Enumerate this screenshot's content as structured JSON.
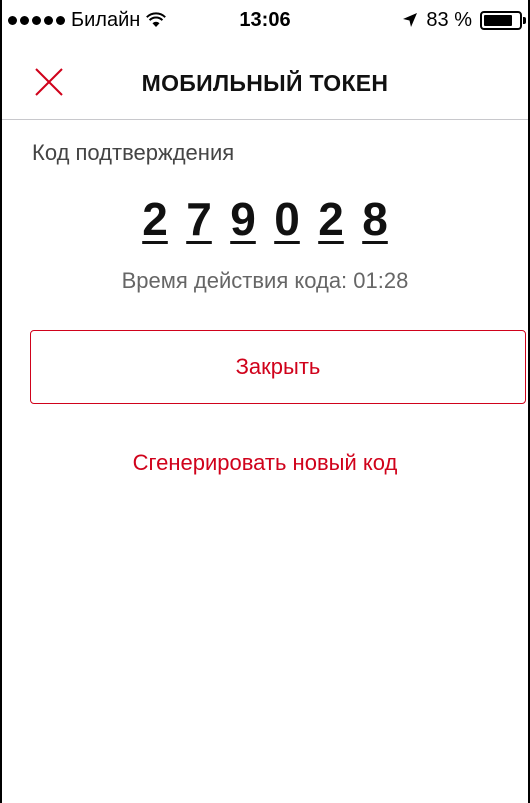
{
  "status_bar": {
    "carrier": "Билайн",
    "time": "13:06",
    "battery_percent": "83 %",
    "battery_level": 0.83,
    "icons": [
      "signal-dots-icon",
      "wifi-icon",
      "location-arrow-icon",
      "battery-icon"
    ]
  },
  "nav": {
    "title": "МОБИЛЬНЫЙ ТОКЕН",
    "close_icon": "close-x-icon"
  },
  "content": {
    "code_label": "Код подтверждения",
    "code_digits": [
      "2",
      "7",
      "9",
      "0",
      "2",
      "8"
    ],
    "timer_label": "Время действия кода:",
    "timer_value": "01:28",
    "close_button": "Закрыть",
    "regenerate_link": "Сгенерировать новый код"
  },
  "colors": {
    "accent": "#d0021b",
    "text": "#111111",
    "muted": "#666666",
    "divider": "#c8c8cc"
  }
}
